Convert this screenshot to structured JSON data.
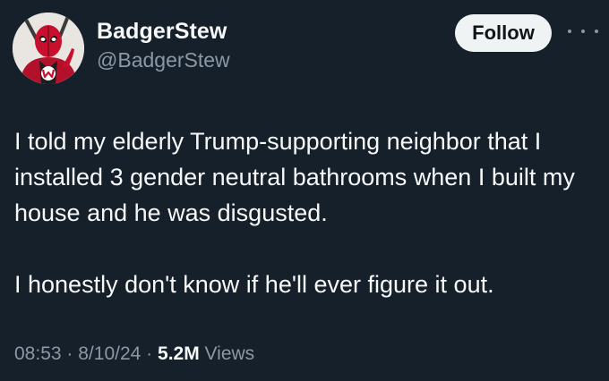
{
  "author": {
    "display_name": "BadgerStew",
    "handle": "@BadgerStew",
    "avatar_icon": "masked-hero-avatar-icon"
  },
  "actions": {
    "follow_label": "Follow",
    "more_icon": "more-horizontal-icon"
  },
  "tweet": {
    "paragraph_1": "I told my elderly Trump-supporting neighbor that I installed 3 gender neutral bathrooms when I built my house and he was disgusted.",
    "paragraph_2": "I honestly don't know if he'll ever figure it out."
  },
  "meta": {
    "time": "08:53",
    "date": "8/10/24",
    "separator": "·",
    "views_count": "5.2M",
    "views_label": "Views"
  },
  "colors": {
    "background": "#15202b",
    "text_primary": "#f7f9f9",
    "text_secondary": "#8b98a5",
    "follow_button_bg": "#eff3f4",
    "avatar_red": "#c8102e"
  }
}
